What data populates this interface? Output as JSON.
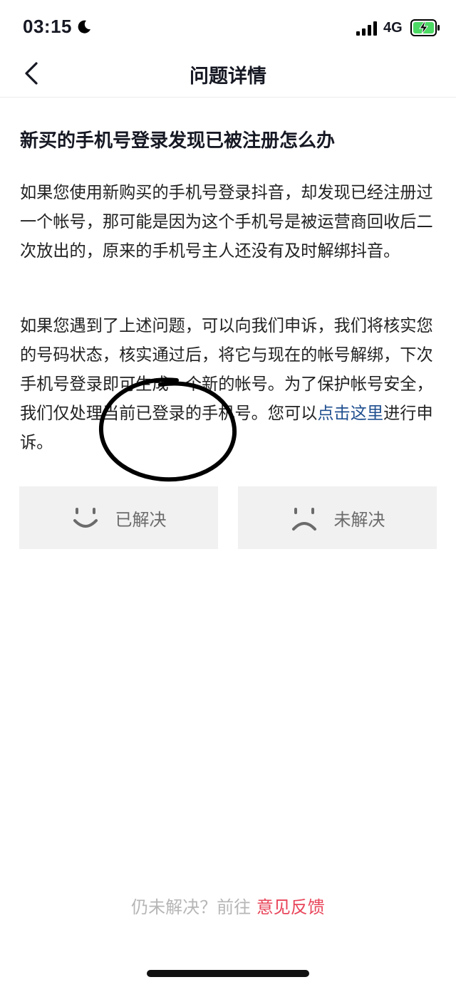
{
  "status_bar": {
    "time": "03:15",
    "network": "4G"
  },
  "nav": {
    "title": "问题详情"
  },
  "article": {
    "title": "新买的手机号登录发现已被注册怎么办",
    "paragraph1": "如果您使用新购买的手机号登录抖音，却发现已经注册过一个帐号，那可能是因为这个手机号是被运营商回收后二次放出的，原来的手机号主人还没有及时解绑抖音。",
    "paragraph2_text": "如果您遇到了上述问题，可以向我们申诉，我们将核实您的号码状态，核实通过后，将它与现在的帐号解绑，下次手机号登录即可生成一个新的帐号。为了保护帐号安全，我们仅处理当前已登录的手机号。您可以",
    "paragraph2_link": "点击这里",
    "paragraph2_suffix": "进行申诉。"
  },
  "feedback": {
    "resolved_label": "已解决",
    "unresolved_label": "未解决"
  },
  "footer": {
    "prompt": "仍未解决？前往",
    "link": "意见反馈"
  },
  "colors": {
    "link": "#1f4f8f",
    "feedback_link": "#e8455a",
    "annotation": "#000000"
  }
}
